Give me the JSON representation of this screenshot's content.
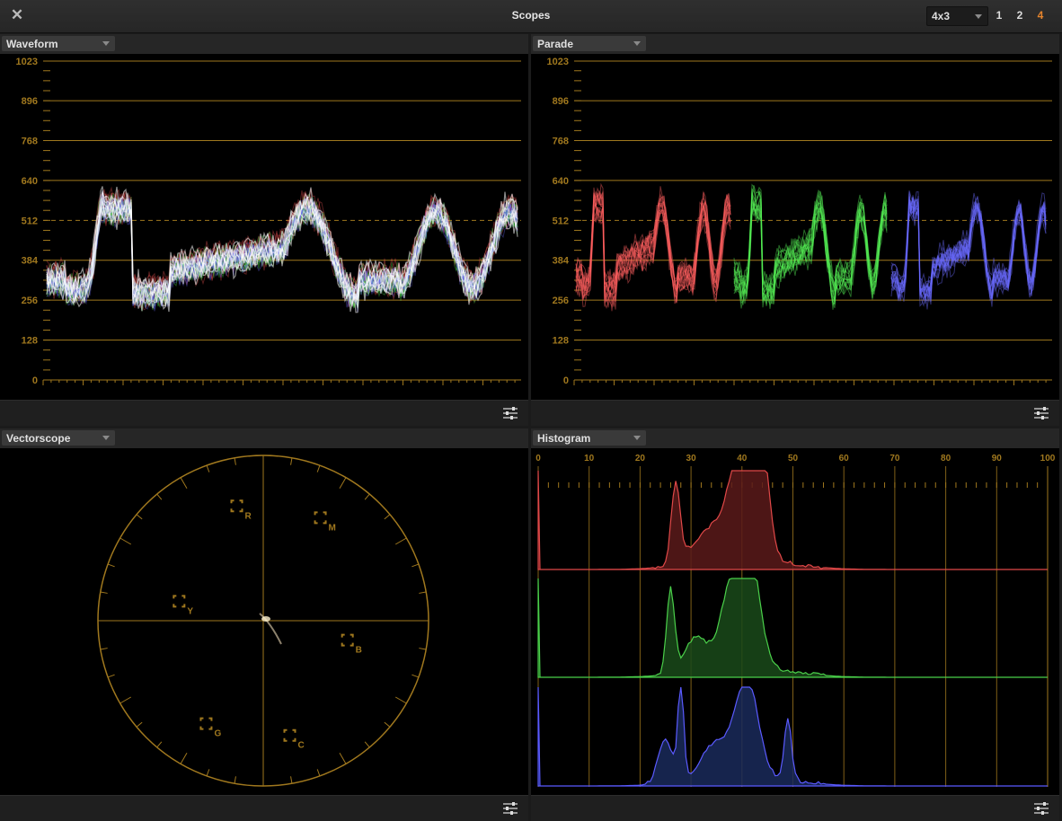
{
  "window": {
    "title": "Scopes",
    "close_icon": "close-icon",
    "layout_value": "4x3",
    "layout_buttons": [
      "1",
      "2",
      "4"
    ],
    "active_layout_button": "4",
    "accent_color": "#e6842c"
  },
  "panels": {
    "waveform": {
      "label": "Waveform"
    },
    "parade": {
      "label": "Parade"
    },
    "vectorscope": {
      "label": "Vectorscope"
    },
    "histogram": {
      "label": "Histogram"
    }
  },
  "waveform_axis": {
    "ticks": [
      "1023",
      "896",
      "768",
      "640",
      "512",
      "384",
      "256",
      "128",
      "0"
    ]
  },
  "vectorscope_targets": [
    "R",
    "M",
    "Y",
    "B",
    "G",
    "C"
  ],
  "histogram_axis": {
    "ticks": [
      "0",
      "10",
      "20",
      "30",
      "40",
      "50",
      "60",
      "70",
      "80",
      "90",
      "100"
    ]
  },
  "colors": {
    "graticule": "#a0781e",
    "red": "#e04848",
    "green": "#4ad04a",
    "blue": "#5a5aff"
  },
  "settings_icon": "sliders-icon"
}
